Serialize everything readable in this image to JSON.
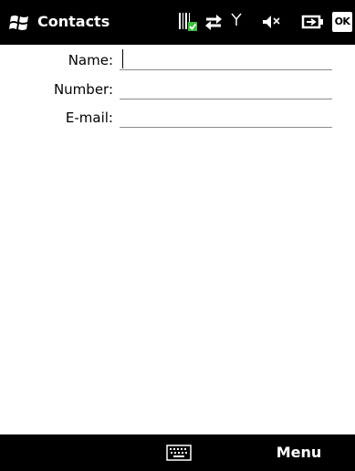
{
  "titlebar": {
    "app_title": "Contacts",
    "ok_label": "OK",
    "icons": [
      "windows-start-icon",
      "barcode-scanner-icon",
      "connectivity-icon",
      "signal-icon",
      "volume-muted-icon",
      "battery-charging-icon"
    ]
  },
  "form": {
    "name_label": "Name:",
    "number_label": "Number:",
    "email_label": "E-mail:",
    "name_value": "",
    "number_value": "",
    "email_value": ""
  },
  "menubar": {
    "menu_label": "Menu",
    "icons": [
      "keyboard-icon"
    ]
  },
  "colors": {
    "bar_background": "#000000",
    "page_background": "#ffffff",
    "status_green": "#3fbf3f"
  }
}
